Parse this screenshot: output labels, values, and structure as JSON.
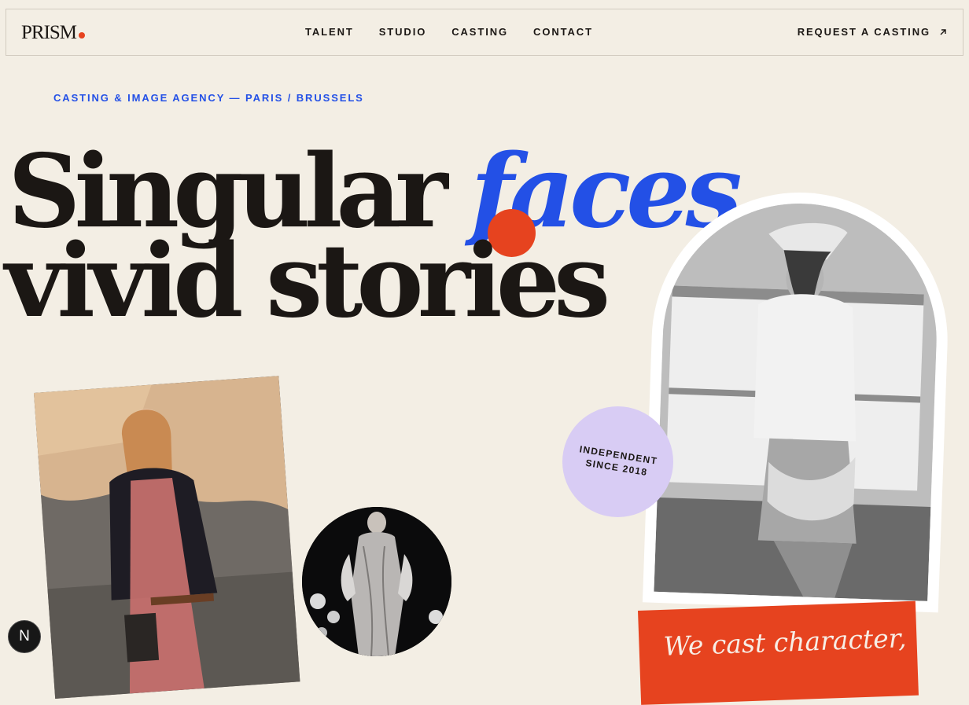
{
  "brand": {
    "logo": "PRISM",
    "accent": "#e6431f"
  },
  "nav": {
    "items": [
      "TALENT",
      "STUDIO",
      "CASTING",
      "CONTACT"
    ],
    "cta": "REQUEST A CASTING"
  },
  "hero": {
    "eyebrow": "CASTING & IMAGE AGENCY — PARIS / BRUSSELS",
    "line1_word1": "Singular",
    "line1_word2": "faces,",
    "line2": "vivid stories"
  },
  "badge": {
    "line1": "INDEPENDENT",
    "line2": "SINCE 2018"
  },
  "card": {
    "text": "We cast character,"
  },
  "dev_badge": {
    "letter": "N"
  },
  "photos": [
    "model-seated-red-dress",
    "runway-silver-gown",
    "black-white-portrait-window"
  ],
  "colors": {
    "background": "#f3eee4",
    "blue": "#2350e6",
    "orange": "#e6431f",
    "lavender": "#d8ccf4",
    "text": "#1b1714"
  }
}
